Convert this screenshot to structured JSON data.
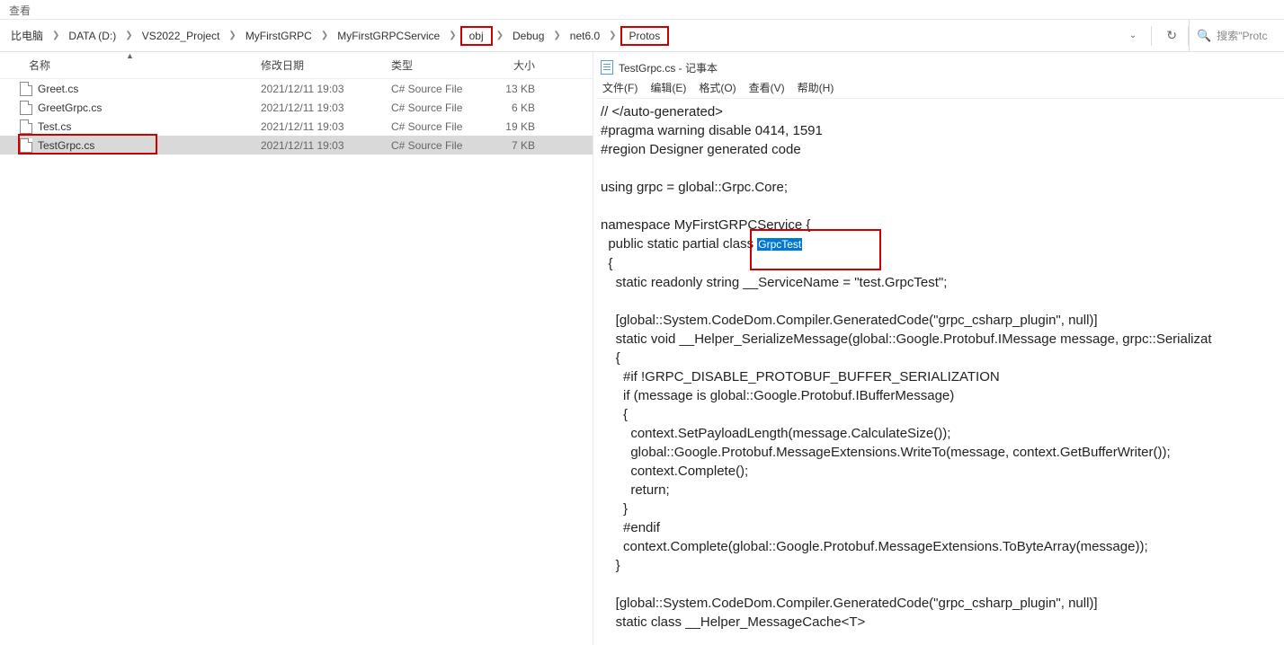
{
  "topbar": {
    "label": "查看"
  },
  "breadcrumb": {
    "items": [
      {
        "label": "比电脑",
        "boxed": false
      },
      {
        "label": "DATA (D:)",
        "boxed": false
      },
      {
        "label": "VS2022_Project",
        "boxed": false
      },
      {
        "label": "MyFirstGRPC",
        "boxed": false
      },
      {
        "label": "MyFirstGRPCService",
        "boxed": false
      },
      {
        "label": "obj",
        "boxed": true
      },
      {
        "label": "Debug",
        "boxed": false
      },
      {
        "label": "net6.0",
        "boxed": false
      },
      {
        "label": "Protos",
        "boxed": true
      }
    ]
  },
  "search": {
    "placeholder": "搜索\"Protc"
  },
  "columns": {
    "name": "名称",
    "date": "修改日期",
    "type": "类型",
    "size": "大小"
  },
  "files": [
    {
      "name": "Greet.cs",
      "date": "2021/12/11 19:03",
      "type": "C# Source File",
      "size": "13 KB",
      "selected": false
    },
    {
      "name": "GreetGrpc.cs",
      "date": "2021/12/11 19:03",
      "type": "C# Source File",
      "size": "6 KB",
      "selected": false
    },
    {
      "name": "Test.cs",
      "date": "2021/12/11 19:03",
      "type": "C# Source File",
      "size": "19 KB",
      "selected": false
    },
    {
      "name": "TestGrpc.cs",
      "date": "2021/12/11 19:03",
      "type": "C# Source File",
      "size": "7 KB",
      "selected": true
    }
  ],
  "notepad": {
    "title": "TestGrpc.cs - 记事本",
    "menu": {
      "file": "文件(F)",
      "edit": "编辑(E)",
      "format": "格式(O)",
      "view": "查看(V)",
      "help": "帮助(H)"
    },
    "highlight_class": "GrpcTest",
    "code_before_highlight": "// </auto-generated>\n#pragma warning disable 0414, 1591\n#region Designer generated code\n\nusing grpc = global::Grpc.Core;\n\nnamespace MyFirstGRPCService {\n  public static partial class ",
    "code_after_highlight": "\n  {\n    static readonly string __ServiceName = \"test.GrpcTest\";\n\n    [global::System.CodeDom.Compiler.GeneratedCode(\"grpc_csharp_plugin\", null)]\n    static void __Helper_SerializeMessage(global::Google.Protobuf.IMessage message, grpc::Serializat\n    {\n      #if !GRPC_DISABLE_PROTOBUF_BUFFER_SERIALIZATION\n      if (message is global::Google.Protobuf.IBufferMessage)\n      {\n        context.SetPayloadLength(message.CalculateSize());\n        global::Google.Protobuf.MessageExtensions.WriteTo(message, context.GetBufferWriter());\n        context.Complete();\n        return;\n      }\n      #endif\n      context.Complete(global::Google.Protobuf.MessageExtensions.ToByteArray(message));\n    }\n\n    [global::System.CodeDom.Compiler.GeneratedCode(\"grpc_csharp_plugin\", null)]\n    static class __Helper_MessageCache<T>"
  }
}
